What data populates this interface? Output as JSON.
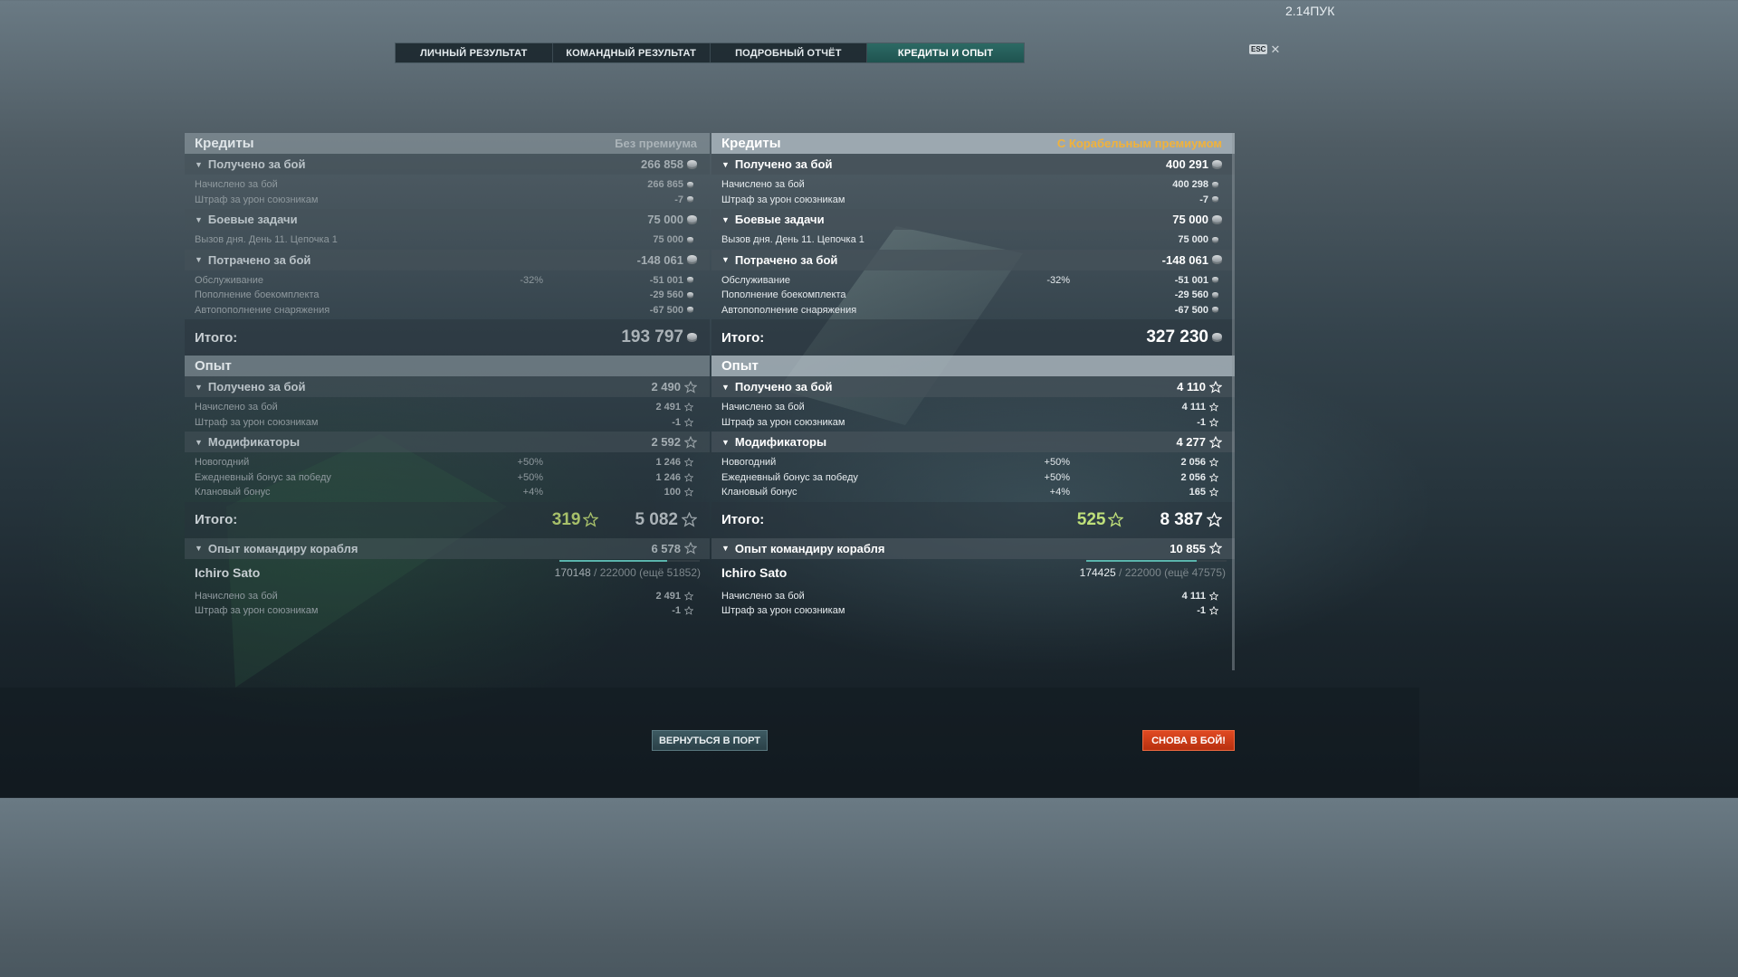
{
  "version": "2.14ПУК",
  "esc": {
    "key": "ESC",
    "close": "✕"
  },
  "tabs": [
    "ЛИЧНЫЙ РЕЗУЛЬТАТ",
    "КОМАНДНЫЙ РЕЗУЛЬТАТ",
    "ПОДРОБНЫЙ ОТЧЁТ",
    "КРЕДИТЫ И ОПЫТ"
  ],
  "active_tab": "КРЕДИТЫ И ОПЫТ",
  "colors": {
    "accent_tab": "#1f5350",
    "premium": "#f1b23a",
    "battle_button": "#c83a18",
    "premium_xp": "#bfe07a"
  },
  "left": {
    "credits_title": "Кредиты",
    "credits_sub": "Без премиума",
    "earned": {
      "label": "Получено за бой",
      "value": "266 858",
      "rows": [
        {
          "name": "Начислено за бой",
          "value": "266 865"
        },
        {
          "name": "Штраф за урон союзникам",
          "value": "-7"
        }
      ]
    },
    "missions": {
      "label": "Боевые задачи",
      "value": "75 000",
      "rows": [
        {
          "name": "Вызов дня. День 11. Цепочка 1",
          "value": "75 000"
        }
      ]
    },
    "spent": {
      "label": "Потрачено за бой",
      "value": "-148 061",
      "rows": [
        {
          "name": "Обслуживание",
          "pct": "-32%",
          "value": "-51 001"
        },
        {
          "name": "Пополнение боекомплекта",
          "value": "-29 560"
        },
        {
          "name": "Автопополнение снаряжения",
          "value": "-67 500"
        }
      ]
    },
    "credits_total_label": "Итого:",
    "credits_total": "193 797",
    "xp_title": "Опыт",
    "xp_earned": {
      "label": "Получено за бой",
      "value": "2 490",
      "rows": [
        {
          "name": "Начислено за бой",
          "value": "2 491"
        },
        {
          "name": "Штраф за урон союзникам",
          "value": "-1"
        }
      ]
    },
    "modifiers": {
      "label": "Модификаторы",
      "value": "2 592",
      "rows": [
        {
          "name": "Новогодний",
          "pct": "+50%",
          "value": "1 246"
        },
        {
          "name": "Ежедневный бонус за победу",
          "pct": "+50%",
          "value": "1 246"
        },
        {
          "name": "Клановый бонус",
          "pct": "+4%",
          "value": "100"
        }
      ]
    },
    "xp_total_label": "Итого:",
    "xp_total_premium": "319",
    "xp_total": "5 082",
    "commander": {
      "label": "Опыт командиру корабля",
      "value": "6 578",
      "name": "Ichiro Sato",
      "progress_current": "170148",
      "progress_rest": "/ 222000 (ещё 51852)",
      "progress_fraction": 0.766,
      "rows": [
        {
          "name": "Начислено за бой",
          "value": "2 491"
        },
        {
          "name": "Штраф за урон союзникам",
          "value": "-1"
        }
      ]
    }
  },
  "right": {
    "credits_title": "Кредиты",
    "credits_sub": "С Корабельным премиумом",
    "earned": {
      "label": "Получено за бой",
      "value": "400 291",
      "rows": [
        {
          "name": "Начислено за бой",
          "value": "400 298"
        },
        {
          "name": "Штраф за урон союзникам",
          "value": "-7"
        }
      ]
    },
    "missions": {
      "label": "Боевые задачи",
      "value": "75 000",
      "rows": [
        {
          "name": "Вызов дня. День 11. Цепочка 1",
          "value": "75 000"
        }
      ]
    },
    "spent": {
      "label": "Потрачено за бой",
      "value": "-148 061",
      "rows": [
        {
          "name": "Обслуживание",
          "pct": "-32%",
          "value": "-51 001"
        },
        {
          "name": "Пополнение боекомплекта",
          "value": "-29 560"
        },
        {
          "name": "Автопополнение снаряжения",
          "value": "-67 500"
        }
      ]
    },
    "credits_total_label": "Итого:",
    "credits_total": "327 230",
    "xp_title": "Опыт",
    "xp_earned": {
      "label": "Получено за бой",
      "value": "4 110",
      "rows": [
        {
          "name": "Начислено за бой",
          "value": "4 111"
        },
        {
          "name": "Штраф за урон союзникам",
          "value": "-1"
        }
      ]
    },
    "modifiers": {
      "label": "Модификаторы",
      "value": "4 277",
      "rows": [
        {
          "name": "Новогодний",
          "pct": "+50%",
          "value": "2 056"
        },
        {
          "name": "Ежедневный бонус за победу",
          "pct": "+50%",
          "value": "2 056"
        },
        {
          "name": "Клановый бонус",
          "pct": "+4%",
          "value": "165"
        }
      ]
    },
    "xp_total_label": "Итого:",
    "xp_total_premium": "525",
    "xp_total": "8 387",
    "commander": {
      "label": "Опыт командиру корабля",
      "value": "10 855",
      "name": "Ichiro Sato",
      "progress_current": "174425",
      "progress_rest": "/ 222000 (ещё 47575)",
      "progress_fraction": 0.786,
      "rows": [
        {
          "name": "Начислено за бой",
          "value": "4 111"
        },
        {
          "name": "Штраф за урон союзникам",
          "value": "-1"
        }
      ]
    }
  },
  "buttons": {
    "port": "ВЕРНУТЬСЯ В ПОРТ",
    "battle": "СНОВА В БОЙ!"
  }
}
